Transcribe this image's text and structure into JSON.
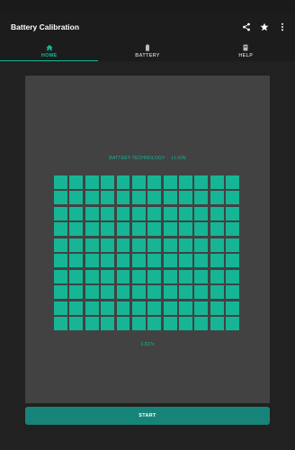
{
  "app": {
    "title": "Battery Calibration"
  },
  "appbar": {
    "actions": [
      "share-icon",
      "star-icon",
      "more-icon"
    ]
  },
  "tabs": [
    {
      "label": "HOME",
      "icon": "home-icon",
      "active": true
    },
    {
      "label": "BATTERY",
      "icon": "battery-icon",
      "active": false
    },
    {
      "label": "HELP",
      "icon": "book-icon",
      "active": false
    }
  ],
  "battery": {
    "technology_label": "BATTERY TECHNOLOGY :",
    "technology_value": "LI-ION",
    "voltage": "3.827v",
    "grid_rows": 10,
    "grid_cols": 12
  },
  "actions": {
    "start_label": "START"
  },
  "colors": {
    "accent": "#18b59a",
    "cell": "#16b595",
    "button": "#17847a",
    "card": "#424242",
    "background": "#212121"
  }
}
